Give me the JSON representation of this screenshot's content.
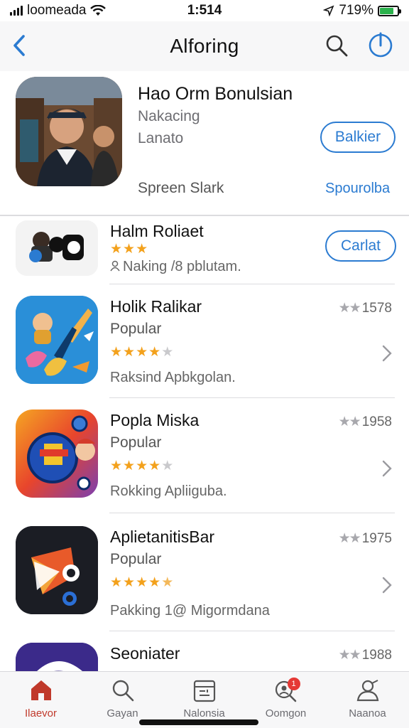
{
  "status_bar": {
    "carrier": "loomeada",
    "time": "1:514",
    "battery_text": "719%",
    "battery_level": 0.8,
    "icons": [
      "signal-icon",
      "wifi-icon",
      "location-icon",
      "battery-icon"
    ]
  },
  "nav": {
    "title": "Alforing",
    "back_icon": "chevron-left-icon",
    "search_icon": "search-icon",
    "power_icon": "power-icon"
  },
  "featured": {
    "title": "Hao Orm Bonulsian",
    "subtitle1": "Nakacing",
    "subtitle2": "Lanato",
    "button_label": "Balkier",
    "footer_text": "Spreen Slark",
    "link_text": "Spourolba"
  },
  "apps": [
    {
      "name": "Halm Roliaet",
      "stars_filled": 3,
      "stars_total": 3,
      "detail": "Naking /8 pblutam.",
      "button_label": "Carlat"
    },
    {
      "name": "Holik Ralikar",
      "category": "Popular",
      "stars_filled": 4,
      "stars_total": 5,
      "detail": "Raksind  Apbkgolan.",
      "rating_text": "1578"
    },
    {
      "name": "Popla Miska",
      "category": "Popular",
      "stars_filled": 4,
      "stars_total": 5,
      "detail": "Rokking  Apliiguba.",
      "rating_text": "1958"
    },
    {
      "name": "AplietanitisBar",
      "category": "Popular",
      "stars_filled": 4.5,
      "stars_total": 5,
      "detail": "Pakking  1@ Migormdana",
      "rating_text": "1975"
    },
    {
      "name": "Seoniater",
      "rating_text": "1988"
    }
  ],
  "tabs": [
    {
      "label": "Ilaevor",
      "icon": "home-icon",
      "active": true
    },
    {
      "label": "Gayan",
      "icon": "search-icon",
      "active": false
    },
    {
      "label": "Nalonsia",
      "icon": "calendar-icon",
      "active": false
    },
    {
      "label": "Oomgon",
      "icon": "person-search-icon",
      "badge": "1",
      "active": false
    },
    {
      "label": "Naanoa",
      "icon": "profile-icon",
      "active": false
    }
  ],
  "colors": {
    "accent": "#2b7bd1",
    "active_tab": "#c0392b",
    "star": "#f3a11c",
    "badge": "#e53935"
  }
}
